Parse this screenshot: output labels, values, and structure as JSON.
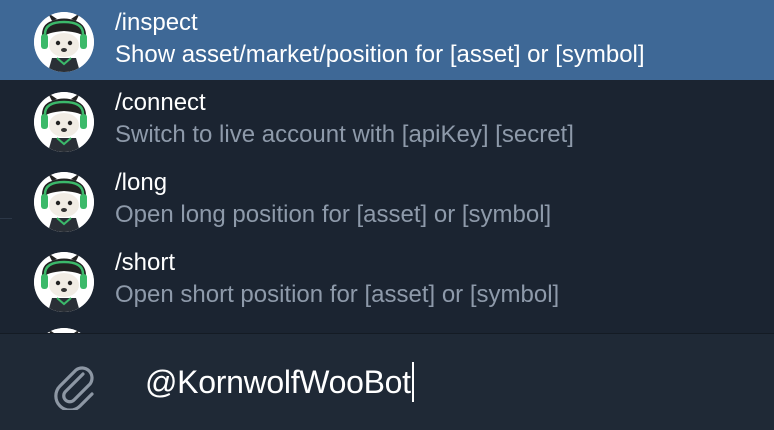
{
  "commands": [
    {
      "name": "/inspect",
      "description": "Show asset/market/position for [asset] or [symbol]",
      "selected": true
    },
    {
      "name": "/connect",
      "description": "Switch to live account with [apiKey] [secret]",
      "selected": false
    },
    {
      "name": "/long",
      "description": "Open long position for [asset] or [symbol]",
      "selected": false
    },
    {
      "name": "/short",
      "description": "Open short position for [asset] or [symbol]",
      "selected": false
    }
  ],
  "composer": {
    "input_value": "@KornwolfWooBot",
    "attach_icon": "paperclip-icon"
  },
  "colors": {
    "background": "#1b2431",
    "selected_row": "#3e6896",
    "description_text": "#8e9aaa",
    "composer_background": "#1f2936"
  },
  "icons": {
    "bot_avatar": "wolf-mascot-avatar-icon"
  }
}
